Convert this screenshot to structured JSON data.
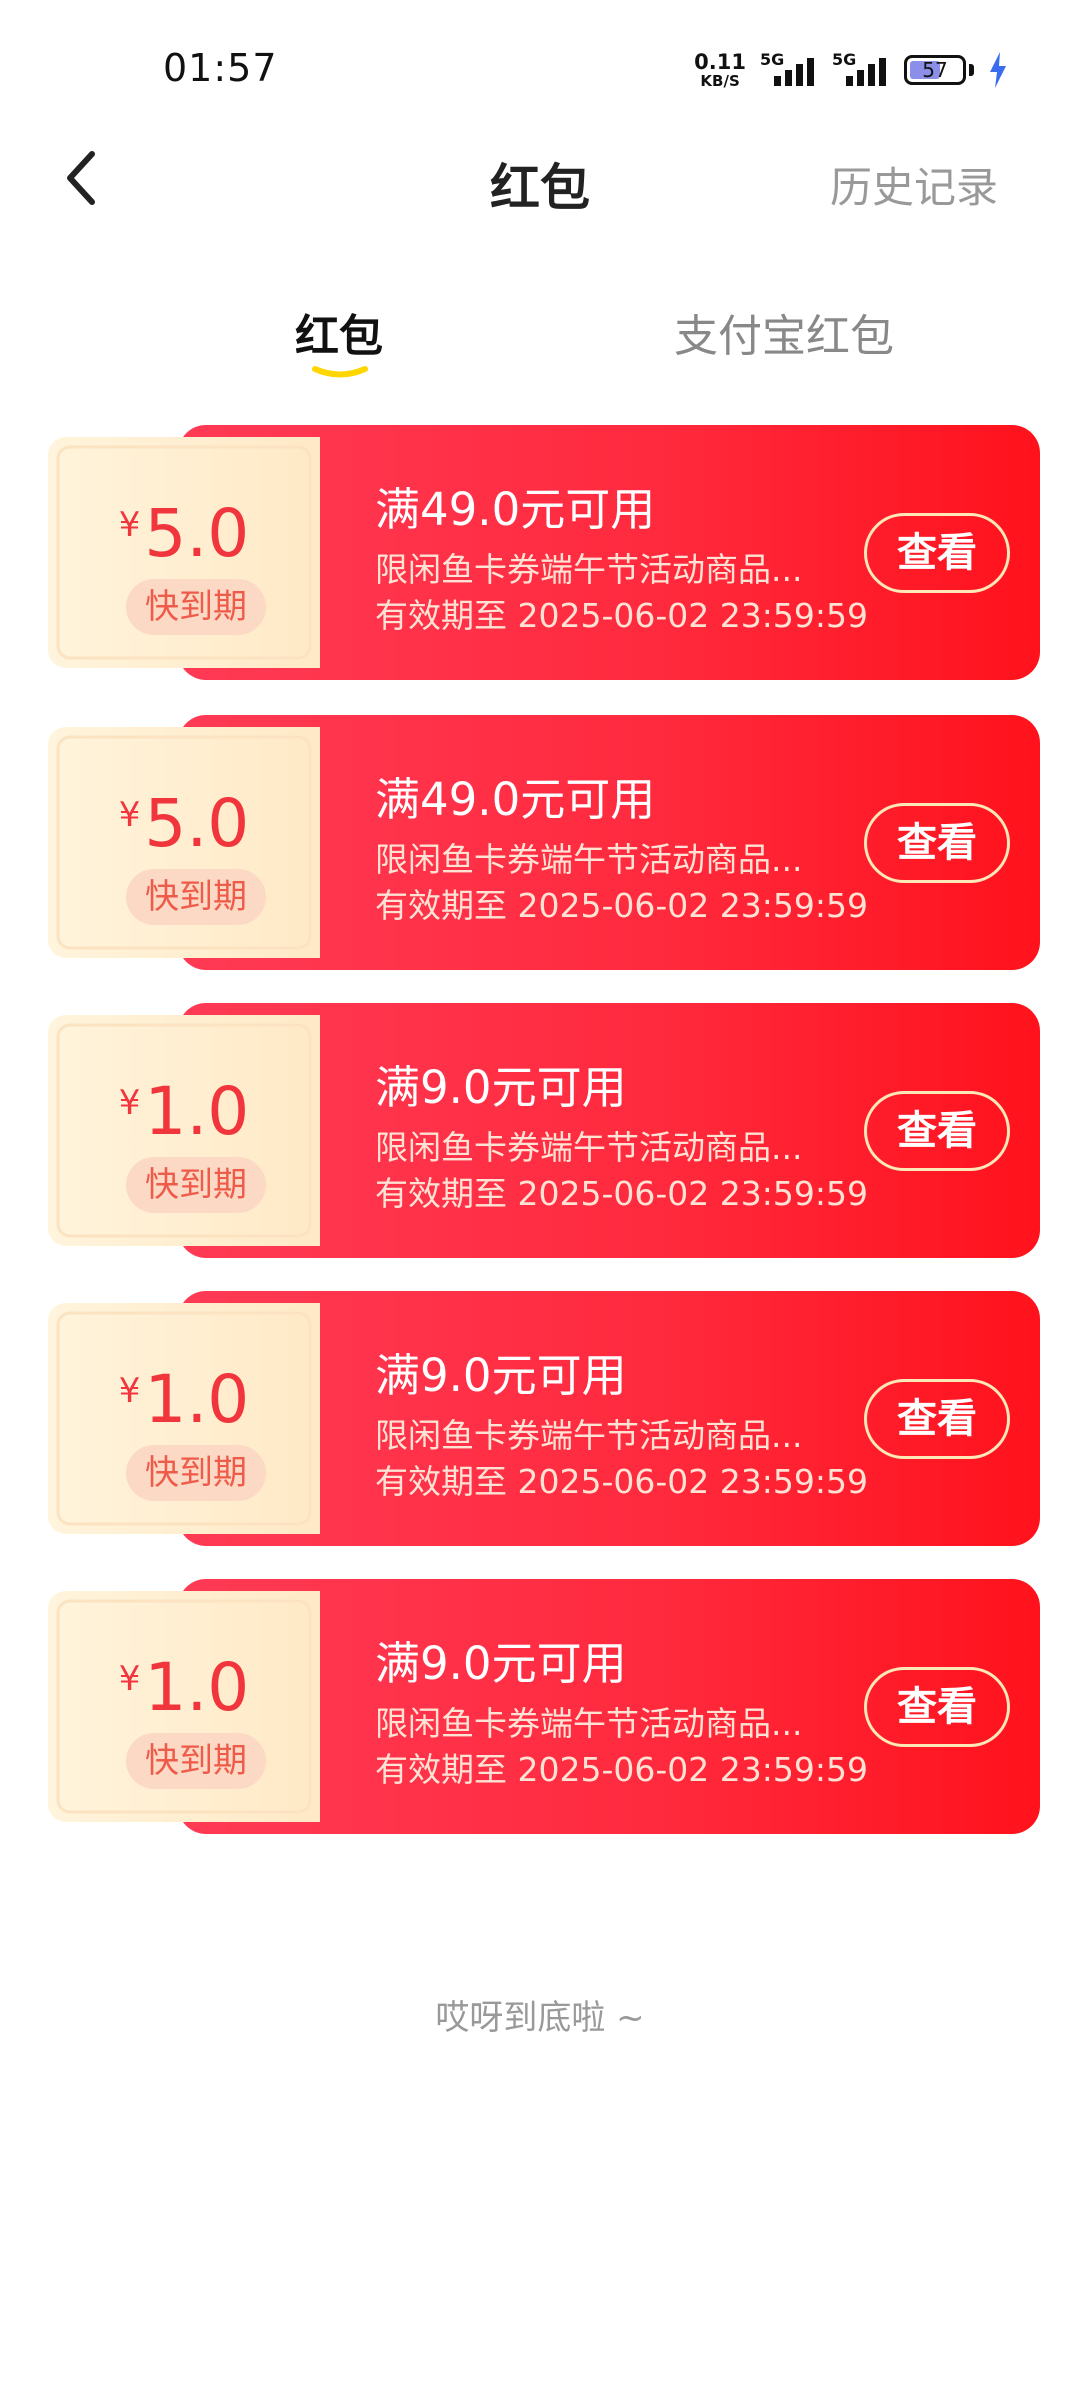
{
  "status_bar": {
    "time": "01:57",
    "net_speed_value": "0.11",
    "net_speed_unit": "KB/S",
    "signal_1": "5G",
    "signal_2": "5G",
    "battery": "57"
  },
  "nav": {
    "title": "红包",
    "history": "历史记录"
  },
  "tabs": [
    {
      "label": "红包",
      "active": true
    },
    {
      "label": "支付宝红包",
      "active": false
    }
  ],
  "coupons": [
    {
      "currency": "¥",
      "amount": "5.0",
      "badge": "快到期",
      "title": "满49.0元可用",
      "desc": "限闲鱼卡券端午节活动商品...",
      "expiry": "有效期至 2025-06-02 23:59:59",
      "action": "查看"
    },
    {
      "currency": "¥",
      "amount": "5.0",
      "badge": "快到期",
      "title": "满49.0元可用",
      "desc": "限闲鱼卡券端午节活动商品...",
      "expiry": "有效期至 2025-06-02 23:59:59",
      "action": "查看"
    },
    {
      "currency": "¥",
      "amount": "1.0",
      "badge": "快到期",
      "title": "满9.0元可用",
      "desc": "限闲鱼卡券端午节活动商品...",
      "expiry": "有效期至 2025-06-02 23:59:59",
      "action": "查看"
    },
    {
      "currency": "¥",
      "amount": "1.0",
      "badge": "快到期",
      "title": "满9.0元可用",
      "desc": "限闲鱼卡券端午节活动商品...",
      "expiry": "有效期至 2025-06-02 23:59:59",
      "action": "查看"
    },
    {
      "currency": "¥",
      "amount": "1.0",
      "badge": "快到期",
      "title": "满9.0元可用",
      "desc": "限闲鱼卡券端午节活动商品...",
      "expiry": "有效期至 2025-06-02 23:59:59",
      "action": "查看"
    }
  ],
  "footer": "哎呀到底啦 ~",
  "colors": {
    "accent_red": "#ff2a3e",
    "tab_underline": "#ffd600",
    "coupon_amount": "#f0353d"
  }
}
